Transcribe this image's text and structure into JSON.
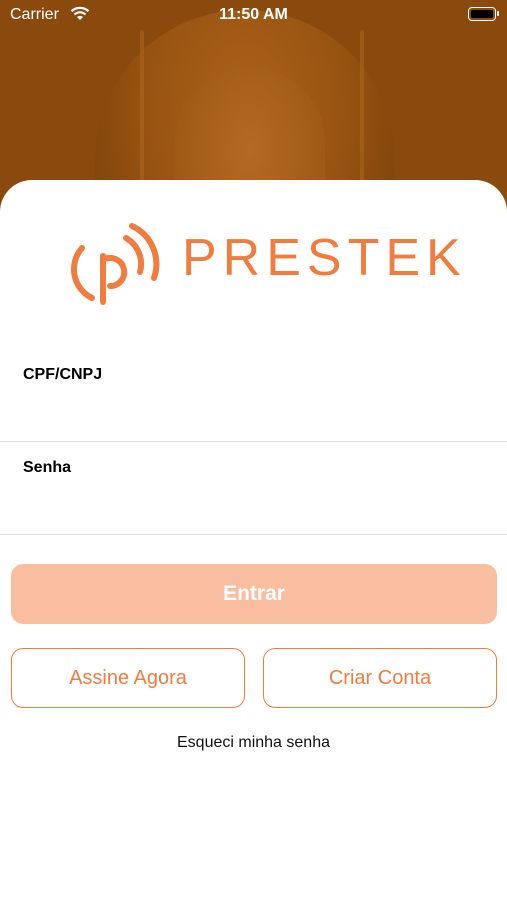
{
  "status_bar": {
    "carrier": "Carrier",
    "time": "11:50 AM"
  },
  "brand": {
    "name": "PRESTEK",
    "accent_color": "#f07c3f",
    "logo_icon": "signal-p-icon"
  },
  "form": {
    "cpf_label": "CPF/CNPJ",
    "cpf_value": "",
    "password_label": "Senha",
    "password_value": ""
  },
  "actions": {
    "login_label": "Entrar",
    "subscribe_label": "Assine Agora",
    "create_account_label": "Criar Conta",
    "forgot_password_label": "Esqueci minha senha"
  },
  "colors": {
    "hero_bg": "#8a4a0e",
    "primary_button_bg": "#f9bea0",
    "outline_border": "#f07c3f"
  }
}
